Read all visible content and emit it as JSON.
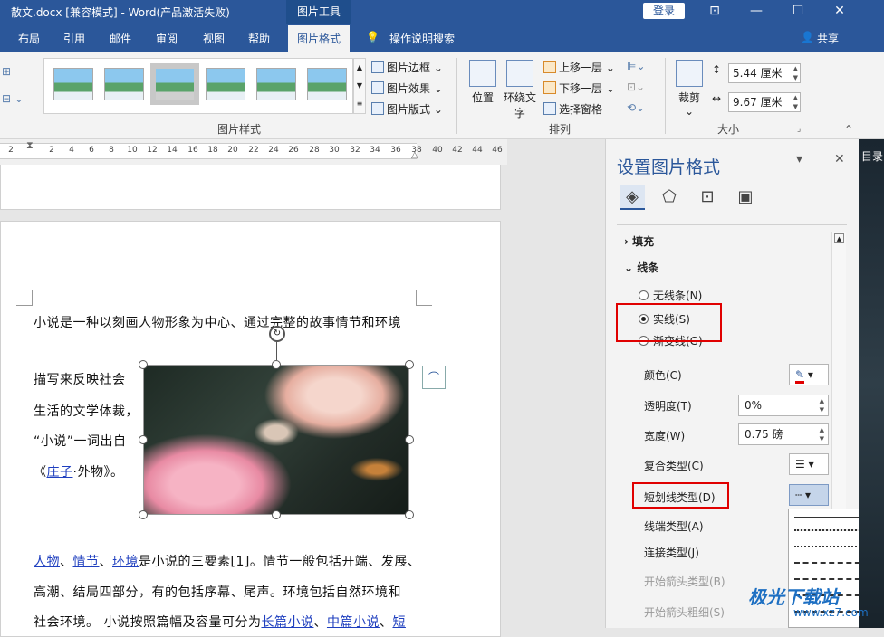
{
  "titlebar": {
    "title": "散文.docx [兼容模式]  -  Word(产品激活失败)",
    "context_tab": "图片工具",
    "login": "登录",
    "btn_ribbon": "⊡",
    "btn_min": "—",
    "btn_max": "☐",
    "btn_close": "✕"
  },
  "tabs": [
    "布局",
    "引用",
    "邮件",
    "审阅",
    "视图",
    "帮助",
    "图片格式"
  ],
  "search": "操作说明搜索",
  "share": "共享",
  "ribbon": {
    "picture_styles_label": "图片样式",
    "border": "图片边框",
    "effects": "图片效果",
    "layout": "图片版式",
    "position": "位置",
    "wrap_text": "环绕文",
    "wrap_text2": "字",
    "bring_forward": "上移一层",
    "send_backward": "下移一层",
    "selection_pane": "选择窗格",
    "arrange_label": "排列",
    "crop": "裁剪",
    "height": "5.44 厘米",
    "width": "9.67 厘米",
    "size_label": "大小"
  },
  "ruler_ticks": [
    "2",
    "2",
    "4",
    "6",
    "8",
    "10",
    "12",
    "14",
    "16",
    "18",
    "20",
    "22",
    "24",
    "26",
    "28",
    "30",
    "32",
    "34",
    "36",
    "38",
    "40",
    "42",
    "44",
    "46"
  ],
  "doc": {
    "line1": "小说是一种以刻画人物形象为中心、通过完整的故事情节和环境",
    "line2": "描写来反映社会",
    "line3": "生活的文学体裁，",
    "line4": "“小说”一词出自",
    "line5a": "《",
    "line5link": "庄子",
    "line5b": "·外物》。",
    "p2_link1": "人物",
    "p2_sep1": "、",
    "p2_link2": "情节",
    "p2_sep2": "、",
    "p2_link3": "环境",
    "p2_rest": "是小说的三要素[1]。情节一般包括开端、发展、",
    "p2_line2": "高潮、结局四部分，有的包括序幕、尾声。环境包括自然环境和",
    "p2_line3a": "社会环境。 小说按照篇幅及容量可分为",
    "p2_line3link1": "长篇小说",
    "p2_line3sep": "、",
    "p2_line3link2": "中篇小说",
    "p2_line3sep2": "、",
    "p2_line3link3": "短"
  },
  "pane": {
    "title": "设置图片格式",
    "fill": "填充",
    "line": "线条",
    "no_line": "无线条(N)",
    "solid_line": "实线(S)",
    "gradient_line": "渐变线(G)",
    "color": "颜色(C)",
    "transparency": "透明度(T)",
    "transparency_value": "0%",
    "width": "宽度(W)",
    "width_value": "0.75 磅",
    "compound": "复合类型(C)",
    "dash": "短划线类型(D)",
    "cap": "线端类型(A)",
    "join": "连接类型(J)",
    "begin_arrow_type": "开始箭头类型(B)",
    "begin_arrow_size": "开始箭头粗细(S)"
  },
  "right_edge": "目录",
  "watermark": "极光下载站",
  "watermark_url": "www.xz7.com"
}
